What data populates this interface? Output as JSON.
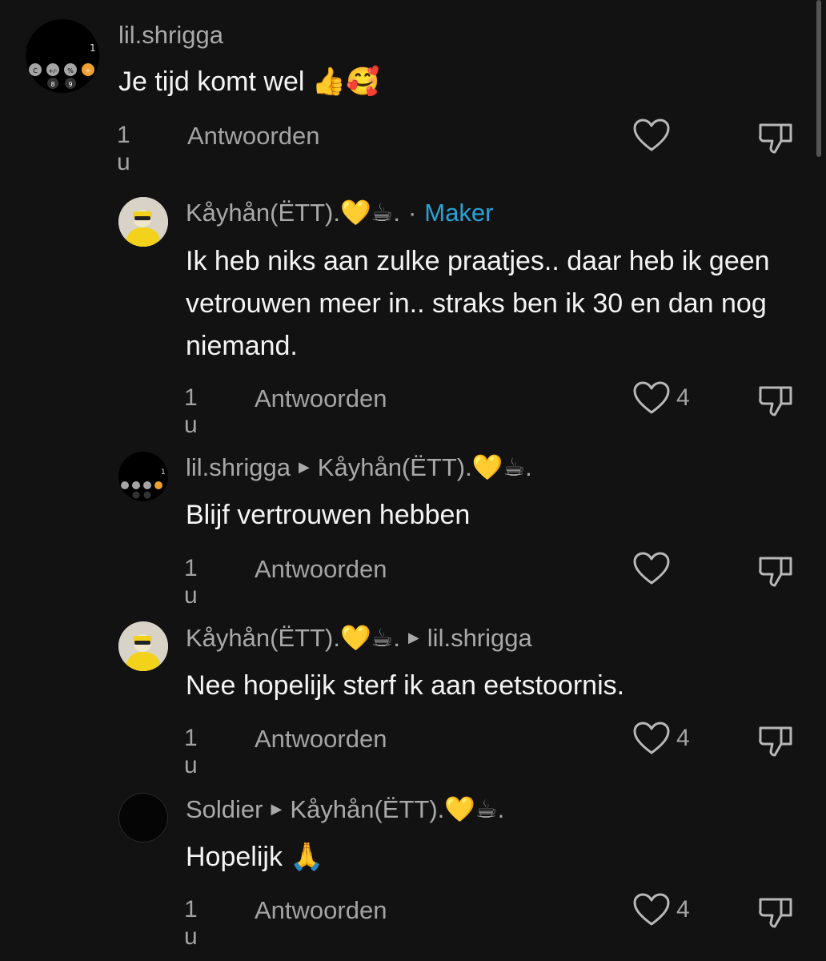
{
  "comments": [
    {
      "author": "lil.shrigga",
      "text": "Je tijd komt wel 👍🥰",
      "time": "1 u",
      "reply_label": "Antwoorden",
      "likes": ""
    },
    {
      "author": "Kåyhån(ËTT).💛☕.",
      "creator_sep": "·",
      "creator_label": "Maker",
      "text": "Ik heb niks aan zulke praatjes.. daar heb ik geen vetrouwen meer in.. straks ben ik 30 en dan nog niemand.",
      "time": "1 u",
      "reply_label": "Antwoorden",
      "likes": "4"
    },
    {
      "author": "lil.shrigga",
      "reply_to": "Kåyhån(ËTT).💛☕.",
      "text": "Blijf vertrouwen hebben",
      "time": "1 u",
      "reply_label": "Antwoorden",
      "likes": ""
    },
    {
      "author": "Kåyhån(ËTT).💛☕.",
      "reply_to": "lil.shrigga",
      "text": "Nee hopelijk sterf ik aan eetstoornis.",
      "time": "1 u",
      "reply_label": "Antwoorden",
      "likes": "4"
    },
    {
      "author": "Soldier",
      "reply_to": "Kåyhån(ËTT).💛☕.",
      "text": "Hopelijk 🙏",
      "time": "1 u",
      "reply_label": "Antwoorden",
      "likes": "4"
    }
  ],
  "avatar_badge": "1",
  "calc_keys": [
    "C",
    "+/-",
    "%",
    "÷",
    "8",
    "9"
  ],
  "icons": {
    "like": "heart-outline-icon",
    "dislike": "thumbs-down-outline-icon",
    "reply_arrow": "triangle-right-icon"
  },
  "colors": {
    "background": "#121212",
    "creator": "#2aa3d6",
    "muted": "#a4a4a4"
  }
}
